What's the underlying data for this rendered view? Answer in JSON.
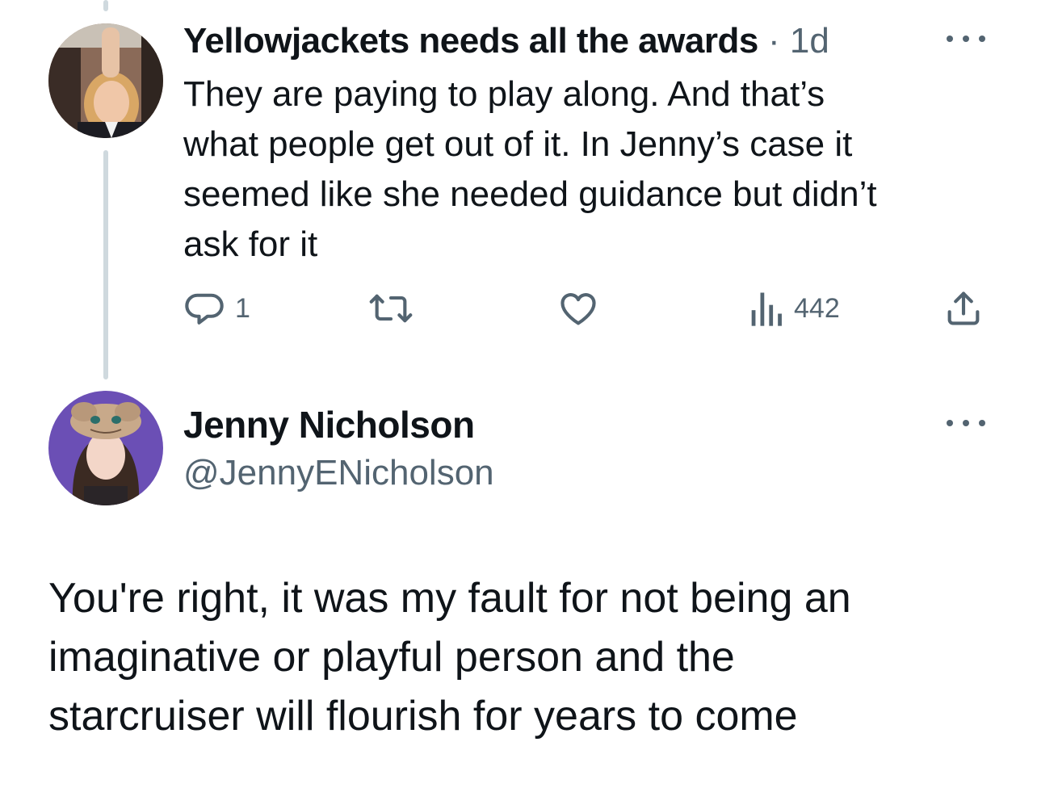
{
  "reply": {
    "display_name": "Yellowjackets needs all the awards",
    "separator": "·",
    "time": "1d",
    "text_lines": [
      "They are paying to play along. And that’s",
      "what people get out of it. In Jenny’s case it",
      "seemed like she needed guidance but didn’t",
      "ask for it"
    ],
    "actions": {
      "reply_count": "1",
      "retweet_count": "",
      "like_count": "",
      "views_count": "442"
    },
    "icons": [
      "reply-icon",
      "retweet-icon",
      "like-icon",
      "views-icon",
      "share-icon",
      "more-icon"
    ]
  },
  "main_tweet": {
    "display_name": "Jenny Nicholson",
    "handle": "@JennyENicholson",
    "text_lines": [
      "You're right, it was my fault for not being an",
      "imaginative or playful person and the",
      "starcruiser will flourish for years to come"
    ]
  },
  "colors": {
    "text": "#0f1419",
    "secondary": "#536471",
    "thread_line": "#cfd9de",
    "avatar_bg_main": "#6b4fb5"
  }
}
